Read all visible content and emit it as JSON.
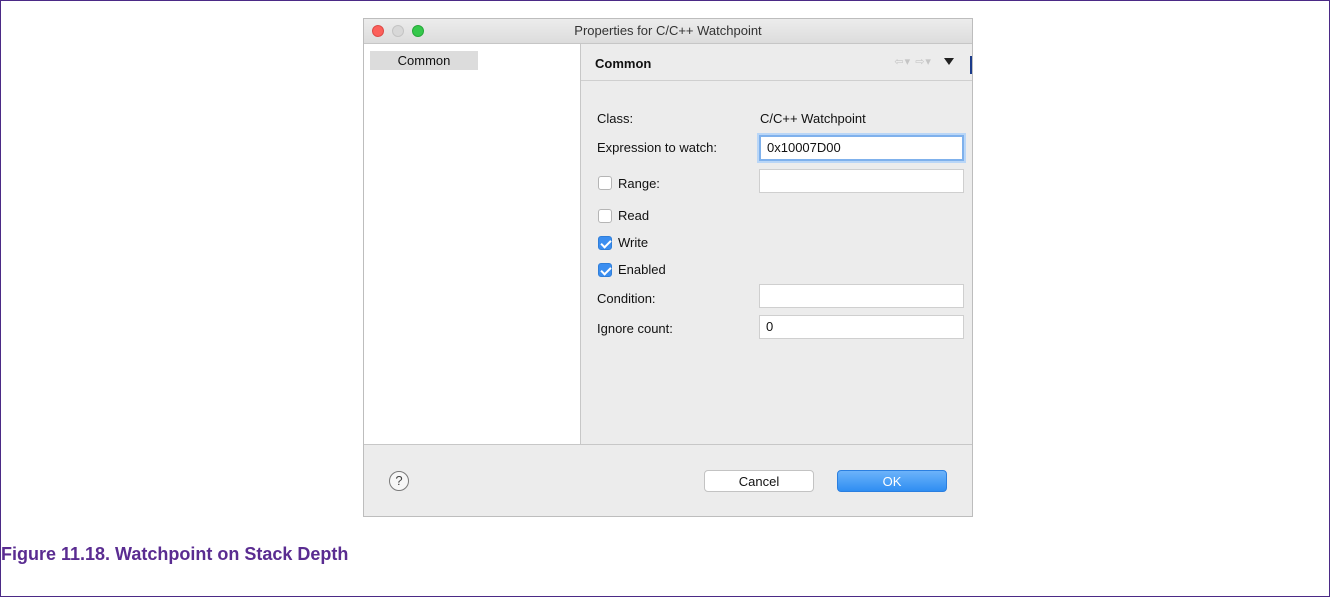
{
  "window": {
    "title": "Properties for C/C++ Watchpoint"
  },
  "sidebar": {
    "items": [
      {
        "label": "Common",
        "selected": true
      }
    ]
  },
  "panel": {
    "title": "Common",
    "nav_icons": [
      "back-arrow-icon",
      "forward-arrow-icon",
      "view-menu-icon"
    ]
  },
  "form": {
    "class_label": "Class:",
    "class_value": "C/C++ Watchpoint",
    "expression_label": "Expression to watch:",
    "expression_value": "0x10007D00",
    "range_label": "Range:",
    "range_checked": false,
    "range_value": "",
    "read_label": "Read",
    "read_checked": false,
    "write_label": "Write",
    "write_checked": true,
    "enabled_label": "Enabled",
    "enabled_checked": true,
    "condition_label": "Condition:",
    "condition_value": "",
    "ignore_label": "Ignore count:",
    "ignore_value": "0"
  },
  "footer": {
    "help_icon": "question-mark-icon",
    "help_glyph": "?",
    "cancel_label": "Cancel",
    "ok_label": "OK"
  },
  "caption": "Figure 11.18. Watchpoint on Stack Depth",
  "colors": {
    "accent": "#3b8ef0",
    "caption": "#5a2c91",
    "close": "#fc605b",
    "maximize": "#35c84b"
  }
}
